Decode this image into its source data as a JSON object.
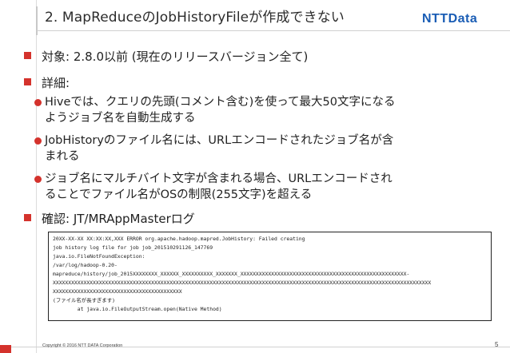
{
  "title": "2. MapReduceのJobHistoryFileが作成できない",
  "logo_text": "NTTData",
  "bullets": [
    {
      "text": "対象: 2.8.0以前 (現在のリリースバージョン全て)"
    },
    {
      "text": "詳細:"
    },
    {
      "text": "確認: JT/MRAppMasterログ"
    }
  ],
  "details": [
    {
      "lines": [
        "Hiveでは、クエリの先頭(コメント含む)を使って最大50文字になる",
        "ようジョブ名を自動生成する"
      ]
    },
    {
      "lines": [
        "JobHistoryのファイル名には、URLエンコードされたジョブ名が含",
        "まれる"
      ]
    },
    {
      "lines": [
        "ジョブ名にマルチバイト文字が含まれる場合、URLエンコードされ",
        "ることでファイル名がOSの制限(255文字)を超える"
      ]
    }
  ],
  "log_lines": [
    "20XX-XX-XX XX:XX:XX,XXX ERROR org.apache.hadoop.mapred.JobHistory: Failed creating",
    "job history log file for job job_201510291126_147769",
    "java.io.FileNotFoundException:",
    "/var/log/hadoop-0.20-",
    "mapreduce/history/job_2015XXXXXXXX_XXXXXX_XXXXXXXXXX_XXXXXXX_XXXXXXXXXXXXXXXXXXXXXXXXXXXXXXXXXXXXXXXXXXXXXXXXXXXXXX-",
    "XXXXXXXXXXXXXXXXXXXXXXXXXXXXXXXXXXXXXXXXXXXXXXXXXXXXXXXXXXXXXXXXXXXXXXXXXXXXXXXXXXXXXXXXXXXXXXXXXXXXXXXXXXXXXXXXXXXXXXXXXXX",
    "XXXXXXXXXXXXXXXXXXXXXXXXXXXXXXXXXXXXXXXXXX",
    "(ファイル名が長すぎます)",
    "        at java.io.FileOutputStream.open(Native Method)"
  ],
  "footer": {
    "copyright": "Copyright © 2016 NTT DATA Corporation",
    "page": "5"
  },
  "colors": {
    "accent": "#d4322c",
    "logo_blue": "#1a5db5"
  }
}
